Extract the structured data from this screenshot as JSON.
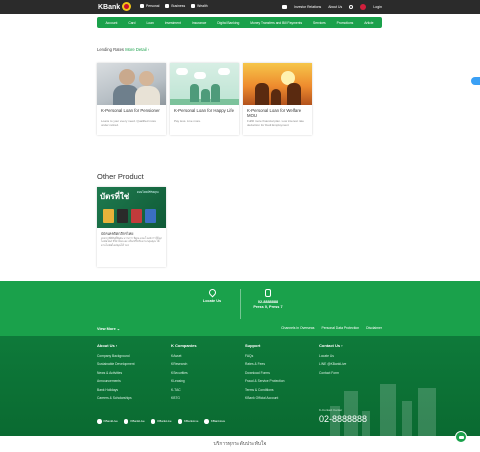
{
  "topbar": {
    "logo": "KBank",
    "left_menu": [
      "Personal",
      "Business",
      "Wealth"
    ],
    "right_menu": [
      "Investor Relations",
      "About Us"
    ],
    "login": "Login"
  },
  "nav": [
    "Account",
    "Card",
    "Loan",
    "Investment",
    "Insurance",
    "Digital Banking",
    "Money Transfers and Bill Payments",
    "Services",
    "Promotions",
    "Article"
  ],
  "lending": {
    "label": "Lending Rates",
    "more": "More Detail"
  },
  "products": [
    {
      "title": "K-Personal Loan for Pensioner",
      "desc": "Loans to your every need. Qualified more under retired."
    },
    {
      "title": "K-Personal Loan for Happy Life",
      "desc": "Pay less. Live more."
    },
    {
      "title": "K-Personal Loan for Welfare MOU",
      "desc": "Fulfill more financial plan. Low interest rate deduction for Dedi Employment"
    }
  ],
  "other": {
    "heading": "Other Product",
    "card_big": "บัตรที่ใช่",
    "card_sub": "ตอบโจทย์ชีวิตคุณ",
    "title": "บัตรเครดิตกสิกรไทย",
    "desc": "สะดวกที่มีสิทธิ์พิเศษ มากกว่า ที่คุณ ตอบโจทย์การใช้ทุกไลฟ์สไตล์ ที่ใช่ ช้อปและ เลือกที่ใช่กับตามกลุ่มคุณ ได้ตามไลฟ์สไตล์คุณได้ ฯลฯ"
  },
  "contact": {
    "locate": "Locate Us",
    "phone": "02-8888888",
    "phone_sub": "Press 0, Press 7"
  },
  "view_more": "View More",
  "vm_links": [
    "Channels in Overseas",
    "Personal Data Protection",
    "Disclaimer"
  ],
  "footer": {
    "about": {
      "heading": "About Us",
      "items": [
        "Company Background",
        "Sustainable Development",
        "News & Activities",
        "Announcements",
        "Bank Holidays",
        "Careers & Scholarships"
      ]
    },
    "kcompanies": {
      "heading": "K Companies",
      "items": [
        "KAsset",
        "KResearch",
        "KSecurities",
        "KLeasing",
        "K-TAC",
        "KBTG"
      ]
    },
    "support": {
      "heading": "Support",
      "items": [
        "FAQs",
        "Rates & Fees",
        "Download Forms",
        "Fraud & Service Protection",
        "Terms & Conditions",
        "KBank Official Account"
      ]
    },
    "contact": {
      "heading": "Contact Us",
      "items": [
        "Locate Us",
        "LINE @KBankLive",
        "Contact Form"
      ]
    },
    "k_contact_label": "K-Contact Center",
    "k_contact_num": "02-8888888",
    "social": [
      "KBankLive",
      "KBankLive",
      "KBankLive",
      "KBankLive",
      "KBankLive"
    ]
  },
  "thai_footer": "บริการทุกระดับประทับใจ",
  "colors": {
    "brand_green": "#1aa14b",
    "dark_green": "#0e7a3a",
    "top_bar": "#2b2b2b"
  }
}
